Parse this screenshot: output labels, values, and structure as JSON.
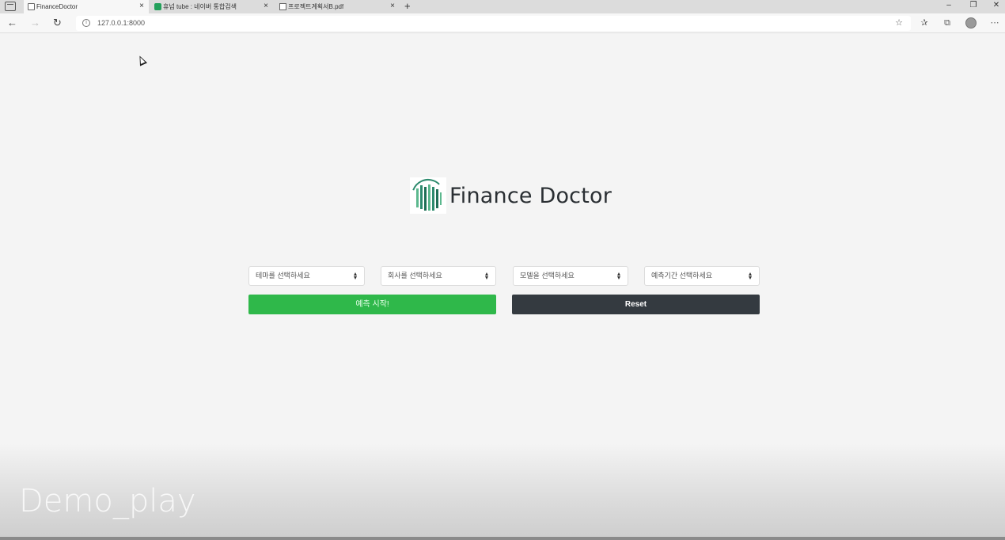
{
  "browser": {
    "tabs": [
      {
        "title": "FinanceDoctor",
        "icon": "document-icon",
        "active": true
      },
      {
        "title": "휴넘 tube : 네이버 통합검색",
        "icon": "naver-icon",
        "active": false
      },
      {
        "title": "프로젝트계획서B.pdf",
        "icon": "pdf-icon",
        "active": false
      }
    ],
    "close_glyph": "×",
    "new_tab_glyph": "+",
    "url": "127.0.0.1:8000",
    "info_glyph": "i"
  },
  "brand": {
    "title": "Finance Doctor",
    "logo_colors": [
      "#2e8b6e",
      "#5cb88e",
      "#1f6f56"
    ]
  },
  "form": {
    "selects": [
      {
        "value": "테마를 선택하세요"
      },
      {
        "value": "회사를 선택하세요"
      },
      {
        "value": "모델을 선택하세요"
      },
      {
        "value": "예측기간 선택하세요"
      }
    ],
    "start_button": "예측 시작!",
    "reset_button": "Reset"
  },
  "watermark": "Demo_play",
  "colors": {
    "start_button": "#2fb84a",
    "reset_button": "#343a40",
    "background": "#f4f4f4"
  }
}
